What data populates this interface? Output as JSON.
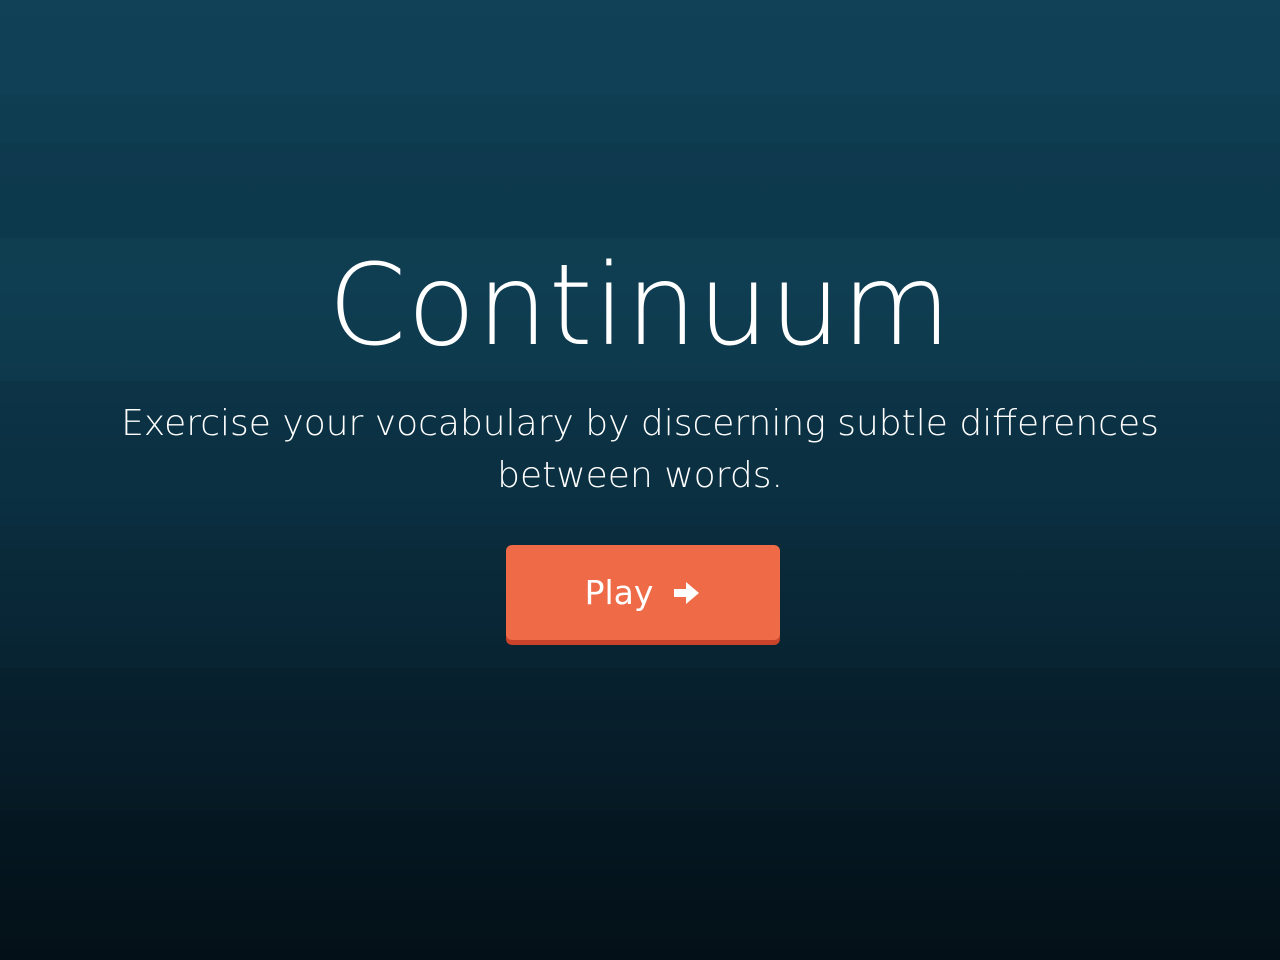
{
  "app": {
    "title": "Continuum",
    "subtitle": "Exercise your vocabulary by discerning subtle differences between words."
  },
  "play_button": {
    "label": "Play",
    "icon": "arrow-right-icon"
  },
  "colors": {
    "background_top": "#0f3f54",
    "background_bottom": "#05141d",
    "accent": "#ef6b48",
    "accent_shadow": "#c9432b",
    "text": "#ffffff"
  }
}
